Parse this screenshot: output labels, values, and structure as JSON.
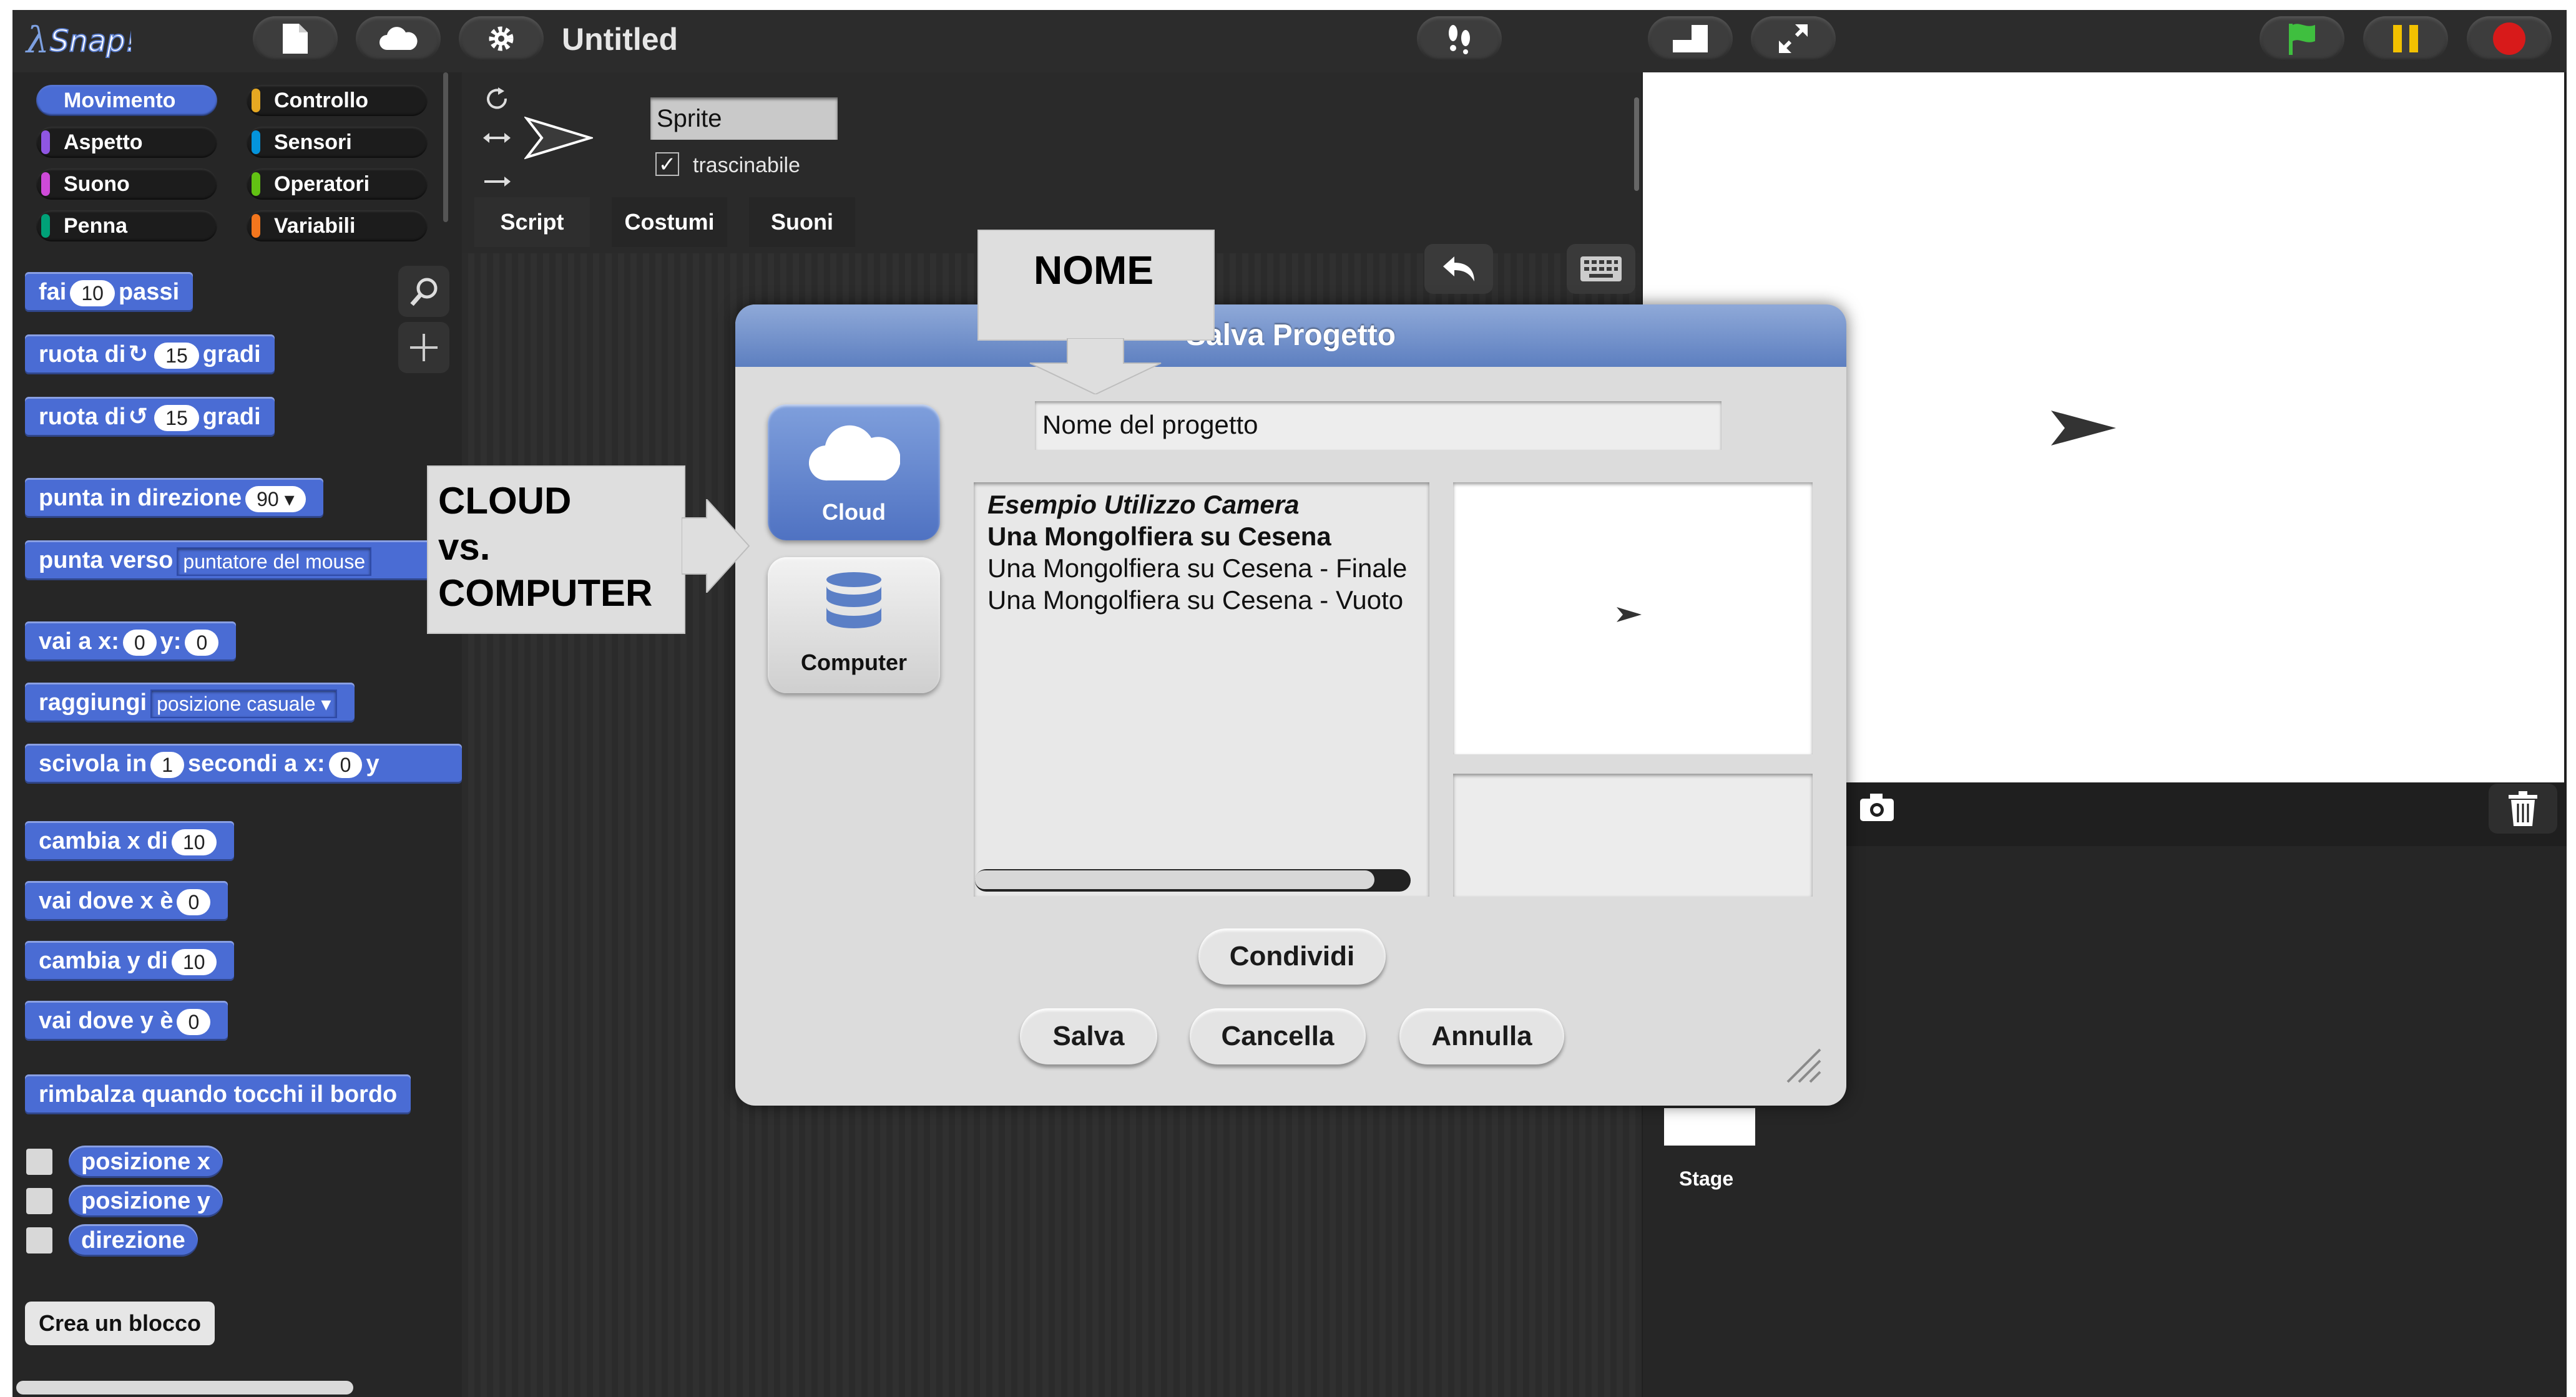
{
  "app": {
    "title": "Untitled"
  },
  "categories": [
    {
      "label": "Movimento",
      "color": "#4a6cd4",
      "selected": true
    },
    {
      "label": "Controllo",
      "color": "#e6a822"
    },
    {
      "label": "Aspetto",
      "color": "#8f56e3"
    },
    {
      "label": "Sensori",
      "color": "#0494dc"
    },
    {
      "label": "Suono",
      "color": "#cf4ad9"
    },
    {
      "label": "Operatori",
      "color": "#62c213"
    },
    {
      "label": "Penna",
      "color": "#00a178"
    },
    {
      "label": "Variabili",
      "color": "#f3761d"
    }
  ],
  "blocks": {
    "move": {
      "a": "fai",
      "v": "10",
      "b": "passi"
    },
    "turn_cw": {
      "a": "ruota di",
      "v": "15",
      "b": "gradi"
    },
    "turn_ccw": {
      "a": "ruota di",
      "v": "15",
      "b": "gradi"
    },
    "point_dir": {
      "a": "punta in direzione",
      "v": "90"
    },
    "point_towards": {
      "a": "punta verso",
      "v": "puntatore del mouse"
    },
    "goto_xy": {
      "a": "vai a x:",
      "x": "0",
      "b": "y:",
      "y": "0"
    },
    "goto": {
      "a": "raggiungi",
      "v": "posizione casuale"
    },
    "glide": {
      "a": "scivola in",
      "v": "1",
      "b": "secondi a x:",
      "x": "0",
      "c": "y"
    },
    "change_x": {
      "a": "cambia x di",
      "v": "10"
    },
    "set_x": {
      "a": "vai dove x è",
      "v": "0"
    },
    "change_y": {
      "a": "cambia y di",
      "v": "10"
    },
    "set_y": {
      "a": "vai dove y è",
      "v": "0"
    },
    "bounce": {
      "a": "rimbalza quando tocchi il bordo"
    },
    "xpos": "posizione x",
    "ypos": "posizione y",
    "direction": "direzione",
    "make_block": "Crea un blocco"
  },
  "sprite": {
    "name": "Sprite",
    "draggable_label": "trascinabile",
    "draggable_checked": true
  },
  "tabs": [
    "Script",
    "Costumi",
    "Suoni"
  ],
  "stage_corral": {
    "stage_label": "Stage"
  },
  "dialog": {
    "title": "Salva Progetto",
    "sources": [
      {
        "label": "Cloud",
        "selected": true
      },
      {
        "label": "Computer",
        "selected": false
      }
    ],
    "name_value": "Nome del progetto",
    "projects": [
      {
        "name": "Esempio Utilizzo Camera",
        "style": "bold-italic"
      },
      {
        "name": "Una Mongolfiera su Cesena",
        "style": "bold"
      },
      {
        "name": "Una Mongolfiera su Cesena - Finale",
        "style": "normal"
      },
      {
        "name": "Una Mongolfiera su Cesena - Vuoto",
        "style": "normal"
      }
    ],
    "buttons": {
      "share": "Condividi",
      "save": "Salva",
      "delete": "Cancella",
      "cancel": "Annulla"
    }
  },
  "callouts": {
    "name": "NOME",
    "source_line1": "CLOUD",
    "source_line2": "vs.",
    "source_line3": "COMPUTER"
  }
}
